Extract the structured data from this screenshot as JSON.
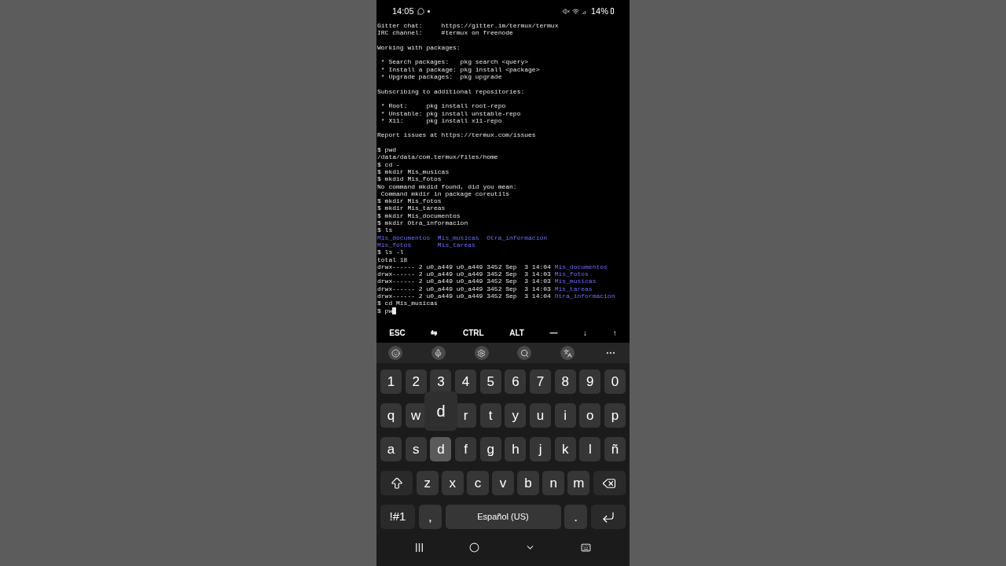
{
  "status_bar": {
    "time": "14:05",
    "battery": "14%"
  },
  "terminal": {
    "lines": [
      {
        "kind": "text",
        "segments": [
          {
            "kind": "plain",
            "text": "Gitter chat:     https://gitter.im/termux/termux"
          }
        ]
      },
      {
        "kind": "text",
        "segments": [
          {
            "kind": "plain",
            "text": "IRC channel:     #termux on freenode"
          }
        ]
      },
      {
        "kind": "blank"
      },
      {
        "kind": "text",
        "segments": [
          {
            "kind": "plain",
            "text": "Working with packages:"
          }
        ]
      },
      {
        "kind": "blank"
      },
      {
        "kind": "text",
        "segments": [
          {
            "kind": "plain",
            "text": " * Search packages:   pkg search <query>"
          }
        ]
      },
      {
        "kind": "text",
        "segments": [
          {
            "kind": "plain",
            "text": " * Install a package: pkg install <package>"
          }
        ]
      },
      {
        "kind": "text",
        "segments": [
          {
            "kind": "plain",
            "text": " * Upgrade packages:  pkg upgrade"
          }
        ]
      },
      {
        "kind": "blank"
      },
      {
        "kind": "text",
        "segments": [
          {
            "kind": "plain",
            "text": "Subscribing to additional repositories:"
          }
        ]
      },
      {
        "kind": "blank"
      },
      {
        "kind": "text",
        "segments": [
          {
            "kind": "plain",
            "text": " * Root:     pkg install root-repo"
          }
        ]
      },
      {
        "kind": "text",
        "segments": [
          {
            "kind": "plain",
            "text": " * Unstable: pkg install unstable-repo"
          }
        ]
      },
      {
        "kind": "text",
        "segments": [
          {
            "kind": "plain",
            "text": " * X11:      pkg install x11-repo"
          }
        ]
      },
      {
        "kind": "blank"
      },
      {
        "kind": "text",
        "segments": [
          {
            "kind": "plain",
            "text": "Report issues at https://termux.com/issues"
          }
        ]
      },
      {
        "kind": "blank"
      },
      {
        "kind": "text",
        "segments": [
          {
            "kind": "plain",
            "text": "$ pwd"
          }
        ]
      },
      {
        "kind": "text",
        "segments": [
          {
            "kind": "plain",
            "text": "/data/data/com.termux/files/home"
          }
        ]
      },
      {
        "kind": "text",
        "segments": [
          {
            "kind": "plain",
            "text": "$ cd -"
          }
        ]
      },
      {
        "kind": "text",
        "segments": [
          {
            "kind": "plain",
            "text": "$ mkdir Mis_musicas"
          }
        ]
      },
      {
        "kind": "text",
        "segments": [
          {
            "kind": "plain",
            "text": "$ mkdid Mis_fotos"
          }
        ]
      },
      {
        "kind": "text",
        "segments": [
          {
            "kind": "plain",
            "text": "No command mkdid found, did you mean:"
          }
        ]
      },
      {
        "kind": "text",
        "segments": [
          {
            "kind": "plain",
            "text": " Command mkdir in package coreutils"
          }
        ]
      },
      {
        "kind": "text",
        "segments": [
          {
            "kind": "plain",
            "text": "$ mkdir Mis_fotos"
          }
        ]
      },
      {
        "kind": "text",
        "segments": [
          {
            "kind": "plain",
            "text": "$ mkdir Mis_tareas"
          }
        ]
      },
      {
        "kind": "text",
        "segments": [
          {
            "kind": "plain",
            "text": "$ mkdir Mis_documentos"
          }
        ]
      },
      {
        "kind": "text",
        "segments": [
          {
            "kind": "plain",
            "text": "$ mkdir Otra_informacion"
          }
        ]
      },
      {
        "kind": "text",
        "segments": [
          {
            "kind": "plain",
            "text": "$ ls"
          }
        ]
      },
      {
        "kind": "columns",
        "items": [
          "Mis_documentos",
          "Mis_musicas",
          "Otra_informacion"
        ]
      },
      {
        "kind": "columns",
        "items": [
          "Mis_fotos",
          "Mis_tareas"
        ]
      },
      {
        "kind": "text",
        "segments": [
          {
            "kind": "plain",
            "text": "$ ls -l"
          }
        ]
      },
      {
        "kind": "text",
        "segments": [
          {
            "kind": "plain",
            "text": "total 18"
          }
        ]
      },
      {
        "kind": "text",
        "segments": [
          {
            "kind": "plain",
            "text": "drwx------ 2 u0_a449 u0_a449 3452 Sep  3 14:04"
          },
          {
            "kind": "dir",
            "text": "Mis_documentos"
          }
        ]
      },
      {
        "kind": "text",
        "segments": [
          {
            "kind": "plain",
            "text": "drwx------ 2 u0_a449 u0_a449 3452 Sep  3 14:03"
          },
          {
            "kind": "dir",
            "text": "Mis_fotos"
          }
        ]
      },
      {
        "kind": "text",
        "segments": [
          {
            "kind": "plain",
            "text": "drwx------ 2 u0_a449 u0_a449 3452 Sep  3 14:03"
          },
          {
            "kind": "dir",
            "text": "Mis_musicas"
          }
        ]
      },
      {
        "kind": "text",
        "segments": [
          {
            "kind": "plain",
            "text": "drwx------ 2 u0_a449 u0_a449 3452 Sep  3 14:03"
          },
          {
            "kind": "dir",
            "text": "Mis_tareas"
          }
        ]
      },
      {
        "kind": "text",
        "segments": [
          {
            "kind": "plain",
            "text": "drwx------ 2 u0_a449 u0_a449 3452 Sep  3 14:04"
          },
          {
            "kind": "dir",
            "text": "Otra_informacion"
          }
        ]
      },
      {
        "kind": "text",
        "segments": [
          {
            "kind": "plain",
            "text": "$ cd Mis_musicas"
          }
        ]
      },
      {
        "kind": "text",
        "segments": [
          {
            "kind": "plain",
            "text": "$ pw"
          },
          {
            "kind": "cursor"
          }
        ]
      }
    ]
  },
  "extra_keys": [
    "ESC",
    "⇆",
    "CTRL",
    "ALT",
    "—",
    "↓",
    "↑"
  ],
  "keyboard": {
    "key_preview": "d",
    "rows": [
      {
        "keys": [
          {
            "kind": "char",
            "label": "1"
          },
          {
            "kind": "char",
            "label": "2"
          },
          {
            "kind": "char",
            "label": "3"
          },
          {
            "kind": "char",
            "label": "4"
          },
          {
            "kind": "char",
            "label": "5"
          },
          {
            "kind": "char",
            "label": "6"
          },
          {
            "kind": "char",
            "label": "7"
          },
          {
            "kind": "char",
            "label": "8"
          },
          {
            "kind": "char",
            "label": "9"
          },
          {
            "kind": "char",
            "label": "0"
          }
        ]
      },
      {
        "keys": [
          {
            "kind": "char",
            "label": "q"
          },
          {
            "kind": "char",
            "label": "w"
          },
          {
            "kind": "covered"
          },
          {
            "kind": "char",
            "label": "r"
          },
          {
            "kind": "char",
            "label": "t"
          },
          {
            "kind": "char",
            "label": "y"
          },
          {
            "kind": "char",
            "label": "u"
          },
          {
            "kind": "char",
            "label": "i"
          },
          {
            "kind": "char",
            "label": "o"
          },
          {
            "kind": "char",
            "label": "p"
          }
        ]
      },
      {
        "keys": [
          {
            "kind": "char",
            "label": "a"
          },
          {
            "kind": "char",
            "label": "s"
          },
          {
            "kind": "char",
            "label": "d",
            "pressed": true
          },
          {
            "kind": "char",
            "label": "f"
          },
          {
            "kind": "char",
            "label": "g"
          },
          {
            "kind": "char",
            "label": "h"
          },
          {
            "kind": "char",
            "label": "j"
          },
          {
            "kind": "char",
            "label": "k"
          },
          {
            "kind": "char",
            "label": "l"
          },
          {
            "kind": "char",
            "label": "ñ"
          }
        ]
      },
      {
        "keys": [
          {
            "kind": "shift"
          },
          {
            "kind": "char",
            "label": "z"
          },
          {
            "kind": "char",
            "label": "x"
          },
          {
            "kind": "char",
            "label": "c"
          },
          {
            "kind": "char",
            "label": "v"
          },
          {
            "kind": "char",
            "label": "b"
          },
          {
            "kind": "char",
            "label": "n"
          },
          {
            "kind": "char",
            "label": "m"
          },
          {
            "kind": "backspace"
          }
        ]
      },
      {
        "keys": [
          {
            "kind": "symbols",
            "label": "!#1"
          },
          {
            "kind": "char",
            "label": ","
          },
          {
            "kind": "space",
            "label": "Español (US)"
          },
          {
            "kind": "char",
            "label": "."
          },
          {
            "kind": "enter"
          }
        ]
      }
    ]
  }
}
